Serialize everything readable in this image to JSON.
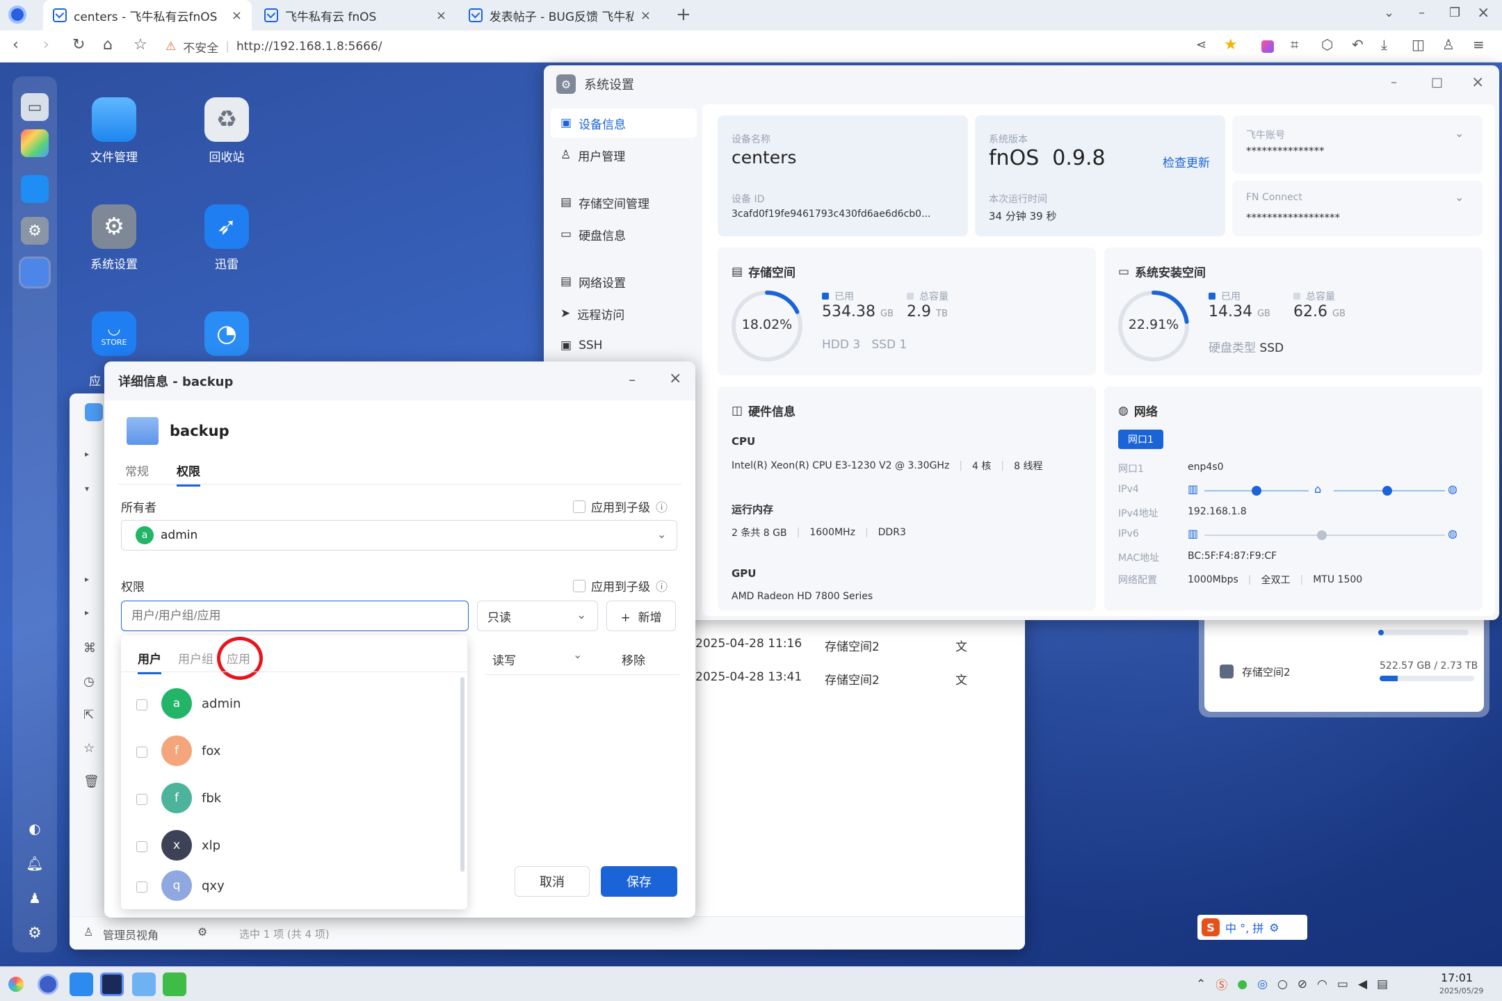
{
  "browser": {
    "tabs": [
      {
        "label": "centers - 飞牛私有云fnOS"
      },
      {
        "label": "飞牛私有云 fnOS"
      },
      {
        "label": "发表帖子 - BUG反馈 飞牛私"
      }
    ],
    "security_label": "不安全",
    "url": "http://192.168.1.8:5666/"
  },
  "desktop": {
    "icons": [
      {
        "label": "文件管理"
      },
      {
        "label": "回收站"
      },
      {
        "label": "系统设置"
      },
      {
        "label": "迅雷"
      },
      {
        "label": "应"
      }
    ],
    "store_text": "STORE"
  },
  "settings": {
    "title": "系统设置",
    "menu": [
      "设备信息",
      "用户管理",
      "存储空间管理",
      "硬盘信息",
      "网络设置",
      "远程访问",
      "SSH"
    ],
    "device_name_label": "设备名称",
    "device_name": "centers",
    "device_id_label": "设备 ID",
    "device_id": "3cafd0f19fe9461793c430fd6ae6d6cb0...",
    "sys_version_label": "系统版本",
    "sys_version": "fnOS  0.9.8",
    "check_update": "检查更新",
    "uptime_label": "本次运行时间",
    "uptime": "34 分钟 39 秒",
    "fn_account_label": "飞牛账号",
    "fn_account": "***************",
    "fn_connect_label": "FN Connect",
    "fn_connect": "******************",
    "storage": {
      "title": "存储空间",
      "percent": "18.02%",
      "percent_value": 18.02,
      "used_label": "已用",
      "used": "534.38",
      "used_unit": "GB",
      "total_label": "总容量",
      "total": "2.9",
      "total_unit": "TB",
      "disks": "HDD 3   SSD 1"
    },
    "sysdisk": {
      "title": "系统安装空间",
      "percent": "22.91%",
      "percent_value": 22.91,
      "used_label": "已用",
      "used": "14.34",
      "used_unit": "GB",
      "total_label": "总容量",
      "total": "62.6",
      "total_unit": "GB",
      "disk_type_label": "硬盘类型",
      "disk_type": "SSD"
    },
    "hardware": {
      "title": "硬件信息",
      "cpu_label": "CPU",
      "cpu": "Intel(R) Xeon(R) CPU E3-1230 V2 @ 3.30GHz",
      "cores": "4 核",
      "threads": "8 线程",
      "mem_label": "运行内存",
      "mem_slots": "2 条共 8 GB",
      "mem_freq": "1600MHz",
      "mem_type": "DDR3",
      "gpu_label": "GPU",
      "gpu": "AMD Radeon HD 7800 Series"
    },
    "network": {
      "title": "网络",
      "port_tab": "网口1",
      "port_label": "网口1",
      "port": "enp4s0",
      "ipv4_label": "IPv4",
      "ipv4addr_label": "IPv4地址",
      "ipv4addr": "192.168.1.8",
      "ipv6_label": "IPv6",
      "mac_label": "MAC地址",
      "mac": "BC:5F:F4:87:F9:CF",
      "config_label": "网络配置",
      "speed": "1000Mbps",
      "duplex": "全双工",
      "mtu": "MTU 1500"
    }
  },
  "filemanager": {
    "rows": [
      {
        "date": "2025-04-28 11:16",
        "loc": "存储空间2",
        "type": "文"
      },
      {
        "date": "2025-04-28 13:41",
        "loc": "存储空间2",
        "type": "文"
      }
    ],
    "footer_view": "管理员视角",
    "footer_status": "选中 1 项 (共 4 项)"
  },
  "storage_widget": {
    "name": "存储空间2",
    "usage": "522.57 GB / 2.73 TB",
    "fill": 0.19
  },
  "dialog": {
    "title": "详细信息 - backup",
    "folder_name": "backup",
    "tabs": [
      "常规",
      "权限"
    ],
    "owner_label": "所有者",
    "apply_child": "应用到子级",
    "owner_value": "admin",
    "owner_avatar": "a",
    "perm_label": "权限",
    "perm_placeholder": "用户/用户组/应用",
    "perm_select": "只读",
    "add_button": "+  新增",
    "row_perm": "读写",
    "row_remove": "移除",
    "picker_tabs": [
      "用户",
      "用户组",
      "应用"
    ],
    "users": [
      {
        "name": "admin",
        "initial": "a",
        "color": "#22b567"
      },
      {
        "name": "fox",
        "initial": "f",
        "color": "#f4a57c"
      },
      {
        "name": "fbk",
        "initial": "f",
        "color": "#4db39a"
      },
      {
        "name": "xlp",
        "initial": "x",
        "color": "#3e4257"
      },
      {
        "name": "qxy",
        "initial": "q",
        "color": "#8fa8e0"
      }
    ],
    "cancel": "取消",
    "save": "保存"
  },
  "ime": {
    "brand": "S",
    "labels": "中 °, 拼"
  },
  "taskbar": {
    "time": "17:01",
    "date": "2025/05/29"
  }
}
